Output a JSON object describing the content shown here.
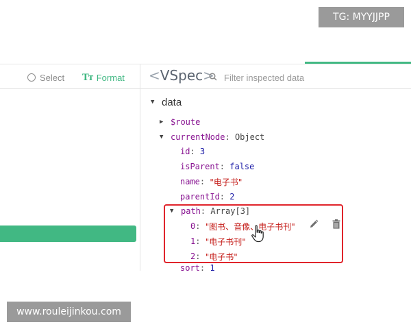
{
  "watermarks": {
    "top": "TG: MYYJJPP",
    "bottom": "www.rouleijinkou.com"
  },
  "left_toolbar": {
    "select_label": "Select",
    "format_label": "Format",
    "format_icon_text": "Tт"
  },
  "right_toolbar": {
    "title": "VSpec",
    "filter_placeholder": "Filter inspected data"
  },
  "colors": {
    "accent": "#41b883",
    "highlight_box": "#e0242b"
  },
  "icons": {
    "select": "circle-icon",
    "format": "text-format-icon",
    "search": "search-icon",
    "edit": "pencil-icon",
    "delete": "trash-icon",
    "cursor": "hand-pointer-icon"
  },
  "tree": {
    "section": "data",
    "route_key": "$route",
    "current_node": {
      "key": "currentNode",
      "type": "Object",
      "id": {
        "key": "id",
        "value": "3"
      },
      "isParent": {
        "key": "isParent",
        "value": "false"
      },
      "name": {
        "key": "name",
        "value": "\"电子书\""
      },
      "parentId": {
        "key": "parentId",
        "value": "2"
      },
      "path": {
        "key": "path",
        "type": "Array[3]",
        "items": [
          {
            "index": "0",
            "value": "\"图书、音像、电子书刊\""
          },
          {
            "index": "1",
            "value": "\"电子书刊\""
          },
          {
            "index": "2",
            "value": "\"电子书\""
          }
        ]
      },
      "sort": {
        "key": "sort",
        "value": "1"
      }
    }
  }
}
